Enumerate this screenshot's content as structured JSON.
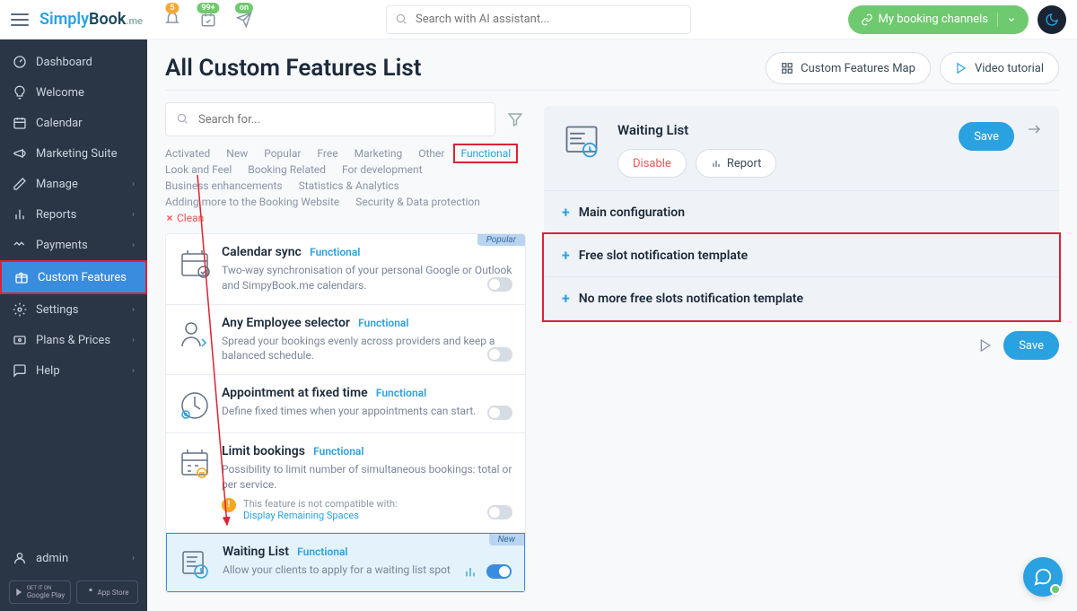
{
  "topbar": {
    "logo_simply": "Simply",
    "logo_book": "Book",
    "logo_me": ".me",
    "badge_bell": "5",
    "badge_cal": "99+",
    "badge_send": "on",
    "search_placeholder": "Search with AI assistant...",
    "channels_label": "My booking channels"
  },
  "sidebar": {
    "items": [
      {
        "label": "Dashboard",
        "icon": "gauge"
      },
      {
        "label": "Welcome",
        "icon": "bulb"
      },
      {
        "label": "Calendar",
        "icon": "calendar"
      },
      {
        "label": "Marketing Suite",
        "icon": "megaphone"
      },
      {
        "label": "Manage",
        "icon": "pencil",
        "chev": true
      },
      {
        "label": "Reports",
        "icon": "barchart",
        "chev": true
      },
      {
        "label": "Payments",
        "icon": "zigzag",
        "chev": true
      },
      {
        "label": "Custom Features",
        "icon": "gift",
        "active": true
      },
      {
        "label": "Settings",
        "icon": "gear",
        "chev": true
      },
      {
        "label": "Plans & Prices",
        "icon": "plan",
        "chev": true
      },
      {
        "label": "Help",
        "icon": "chat",
        "chev": true
      }
    ],
    "admin": "admin",
    "store_google": "Google Play",
    "store_google_sub": "GET IT ON",
    "store_apple": "App Store"
  },
  "page": {
    "title": "All Custom Features List",
    "btn_map": "Custom Features Map",
    "btn_video": "Video tutorial",
    "search_placeholder": "Search for..."
  },
  "filters": [
    "Activated",
    "New",
    "Popular",
    "Free",
    "Marketing",
    "Other",
    "Functional",
    "Look and Feel",
    "Booking Related",
    "For development",
    "Business enhancements",
    "Statistics & Analytics",
    "Adding more to the Booking Website",
    "Security & Data protection"
  ],
  "filter_clean": "Clean",
  "features": [
    {
      "title": "Calendar sync",
      "tag": "Functional",
      "desc": "Two-way synchronisation of your personal Google or Outlook and SimpyBook.me calendars.",
      "badge": "Popular"
    },
    {
      "title": "Any Employee selector",
      "tag": "Functional",
      "desc": "Spread your bookings evenly across providers and keep a balanced schedule."
    },
    {
      "title": "Appointment at fixed time",
      "tag": "Functional",
      "desc": "Define fixed times when your appointments can start."
    },
    {
      "title": "Limit bookings",
      "tag": "Functional",
      "desc": "Possibility to limit number of simultaneous bookings: total or per service.",
      "warn": "This feature is not compatible with:",
      "warn_link": "Display Remaining Spaces"
    },
    {
      "title": "Waiting List",
      "tag": "Functional",
      "desc": "Allow your clients to apply for a waiting list spot",
      "badge": "New",
      "on": true,
      "chart_icon": true
    }
  ],
  "detail": {
    "title": "Waiting List",
    "btn_disable": "Disable",
    "btn_report": "Report",
    "btn_save": "Save",
    "config": [
      "Main configuration",
      "Free slot notification template",
      "No more free slots notification template"
    ],
    "save_btn": "Save"
  }
}
